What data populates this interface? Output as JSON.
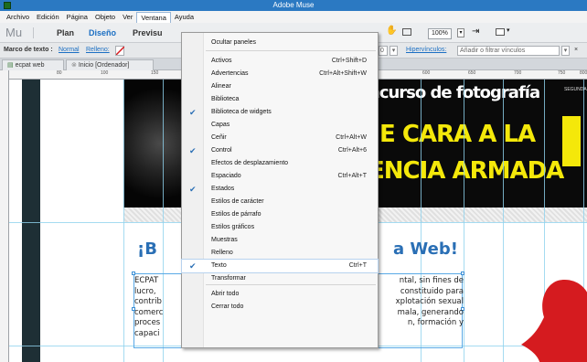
{
  "window": {
    "title": "Adobe Muse"
  },
  "menubar": [
    "Archivo",
    "Edición",
    "Página",
    "Objeto",
    "Ver",
    "Ventana",
    "Ayuda"
  ],
  "modebar": {
    "logo": "Mu",
    "modes": [
      "Plan",
      "Diseño",
      "Previsu"
    ],
    "zoom": "100%"
  },
  "props": {
    "text_frame_label": "Marco de texto :",
    "text_frame_value": "Normal",
    "fill_label": "Relleno:",
    "hyperlinks_label": "Hipervínculos:",
    "hyperlinks_placeholder": "Añadir o filtrar vínculos",
    "small_value": "0"
  },
  "tabs": [
    "ecpat web",
    "Inicio [Ordenador]"
  ],
  "ruler": [
    "80",
    "100",
    "150",
    "600",
    "650",
    "700",
    "750",
    "800"
  ],
  "canvas": {
    "banner_line1": "ncurso de fotografía",
    "banner_line2": "E CARA A LA",
    "banner_line3": "ENCIA ARMADA",
    "banner_side": "SEGUNDA",
    "heading_left": "¡B",
    "heading_right": "a Web!",
    "body_lines": [
      {
        "left": "ECPAT",
        "right": "ntal, sin fines de"
      },
      {
        "left": "lucro,",
        "right": "constituido para"
      },
      {
        "left": "contrib",
        "right": "xplotación sexual"
      },
      {
        "left": "comerc",
        "right": "mala, generando"
      },
      {
        "left": "proces",
        "right": "n, formación y"
      },
      {
        "left": "capaci",
        "right": ""
      }
    ]
  },
  "dropdown": {
    "items": [
      {
        "label": "Ocultar paneles",
        "shortcut": "",
        "checked": false
      },
      {
        "label": "Activos",
        "shortcut": "Ctrl+Shift+D",
        "checked": false
      },
      {
        "label": "Advertencias",
        "shortcut": "Ctrl+Alt+Shift+W",
        "checked": false
      },
      {
        "label": "Alinear",
        "shortcut": "",
        "checked": false
      },
      {
        "label": "Biblioteca",
        "shortcut": "",
        "checked": false
      },
      {
        "label": "Biblioteca de widgets",
        "shortcut": "",
        "checked": true
      },
      {
        "label": "Capas",
        "shortcut": "",
        "checked": false
      },
      {
        "label": "Ceñir",
        "shortcut": "Ctrl+Alt+W",
        "checked": false
      },
      {
        "label": "Control",
        "shortcut": "Ctrl+Alt+6",
        "checked": true
      },
      {
        "label": "Efectos de desplazamiento",
        "shortcut": "",
        "checked": false
      },
      {
        "label": "Espaciado",
        "shortcut": "Ctrl+Alt+T",
        "checked": false
      },
      {
        "label": "Estados",
        "shortcut": "",
        "checked": true
      },
      {
        "label": "Estilos de carácter",
        "shortcut": "",
        "checked": false
      },
      {
        "label": "Estilos de párrafo",
        "shortcut": "",
        "checked": false
      },
      {
        "label": "Estilos gráficos",
        "shortcut": "",
        "checked": false
      },
      {
        "label": "Muestras",
        "shortcut": "",
        "checked": false
      },
      {
        "label": "Relleno",
        "shortcut": "",
        "checked": false
      },
      {
        "label": "Texto",
        "shortcut": "Ctrl+T",
        "checked": true
      },
      {
        "label": "Transformar",
        "shortcut": "",
        "checked": false
      },
      {
        "label": "Abrir todo",
        "shortcut": "",
        "checked": false
      },
      {
        "label": "Cerrar todo",
        "shortcut": "",
        "checked": false
      }
    ]
  },
  "colors": {
    "titlebar": "#2b79c2",
    "banner_yellow": "#f4e80a",
    "heading_blue": "#2a6fb5",
    "guide": "#8fd2ee",
    "accent_red": "#d51b1f"
  }
}
